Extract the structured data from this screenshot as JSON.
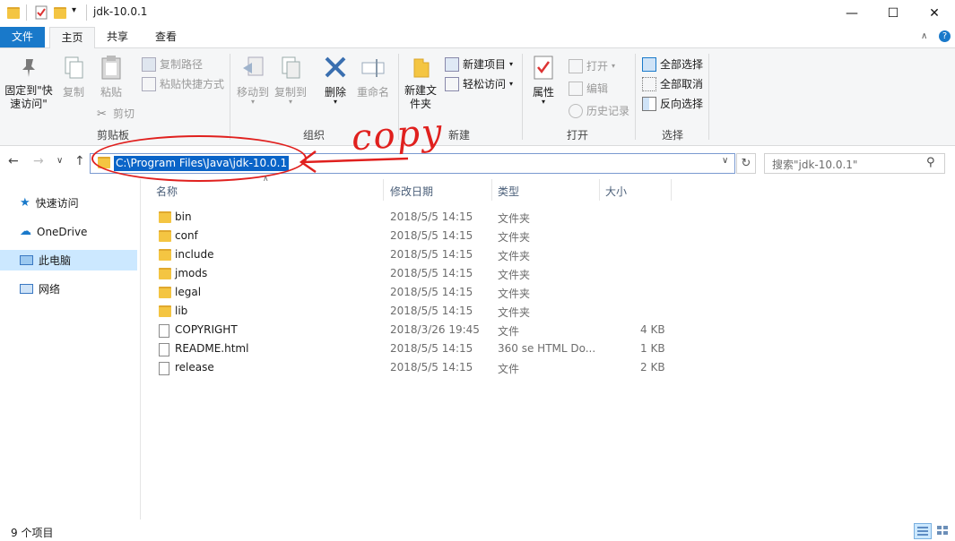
{
  "window": {
    "title": "jdk-10.0.1",
    "minimize_glyph": "—",
    "maximize_glyph": "☐",
    "close_glyph": "✕"
  },
  "tabs": {
    "file": "文件",
    "home": "主页",
    "share": "共享",
    "view": "查看"
  },
  "ribbon": {
    "clipboard": {
      "pin": "固定到\"快速访问\"",
      "copy": "复制",
      "paste": "粘贴",
      "copy_path": "复制路径",
      "paste_shortcut": "粘贴快捷方式",
      "cut": "剪切",
      "label": "剪贴板"
    },
    "organize": {
      "move_to": "移动到",
      "copy_to": "复制到",
      "delete": "删除",
      "rename": "重命名",
      "label": "组织"
    },
    "new": {
      "new_folder": "新建文件夹",
      "new_item": "新建项目",
      "easy_access": "轻松访问",
      "label": "新建"
    },
    "open": {
      "properties": "属性",
      "open": "打开",
      "edit": "编辑",
      "history": "历史记录",
      "label": "打开"
    },
    "select": {
      "select_all": "全部选择",
      "select_none": "全部取消",
      "invert": "反向选择",
      "label": "选择"
    }
  },
  "address": {
    "path": "C:\\Program Files\\Java\\jdk-10.0.1",
    "search_placeholder": "搜索\"jdk-10.0.1\""
  },
  "annotation": {
    "text": "copy"
  },
  "nav": [
    {
      "label": "快速访问",
      "icon": "star-icon"
    },
    {
      "label": "OneDrive",
      "icon": "cloud-icon"
    },
    {
      "label": "此电脑",
      "icon": "computer-icon"
    },
    {
      "label": "网络",
      "icon": "network-icon"
    }
  ],
  "columns": {
    "name": "名称",
    "date": "修改日期",
    "type": "类型",
    "size": "大小"
  },
  "files": [
    {
      "name": "bin",
      "date": "2018/5/5 14:15",
      "type": "文件夹",
      "size": "",
      "kind": "folder"
    },
    {
      "name": "conf",
      "date": "2018/5/5 14:15",
      "type": "文件夹",
      "size": "",
      "kind": "folder"
    },
    {
      "name": "include",
      "date": "2018/5/5 14:15",
      "type": "文件夹",
      "size": "",
      "kind": "folder"
    },
    {
      "name": "jmods",
      "date": "2018/5/5 14:15",
      "type": "文件夹",
      "size": "",
      "kind": "folder"
    },
    {
      "name": "legal",
      "date": "2018/5/5 14:15",
      "type": "文件夹",
      "size": "",
      "kind": "folder"
    },
    {
      "name": "lib",
      "date": "2018/5/5 14:15",
      "type": "文件夹",
      "size": "",
      "kind": "folder"
    },
    {
      "name": "COPYRIGHT",
      "date": "2018/3/26 19:45",
      "type": "文件",
      "size": "4 KB",
      "kind": "file"
    },
    {
      "name": "README.html",
      "date": "2018/5/5 14:15",
      "type": "360 se HTML Do...",
      "size": "1 KB",
      "kind": "file"
    },
    {
      "name": "release",
      "date": "2018/5/5 14:15",
      "type": "文件",
      "size": "2 KB",
      "kind": "file"
    }
  ],
  "status": {
    "count": "9 个项目"
  },
  "colors": {
    "accent": "#1979ca",
    "selection": "#0a64c8",
    "annotation": "#e0201e",
    "folder": "#f4c542"
  }
}
